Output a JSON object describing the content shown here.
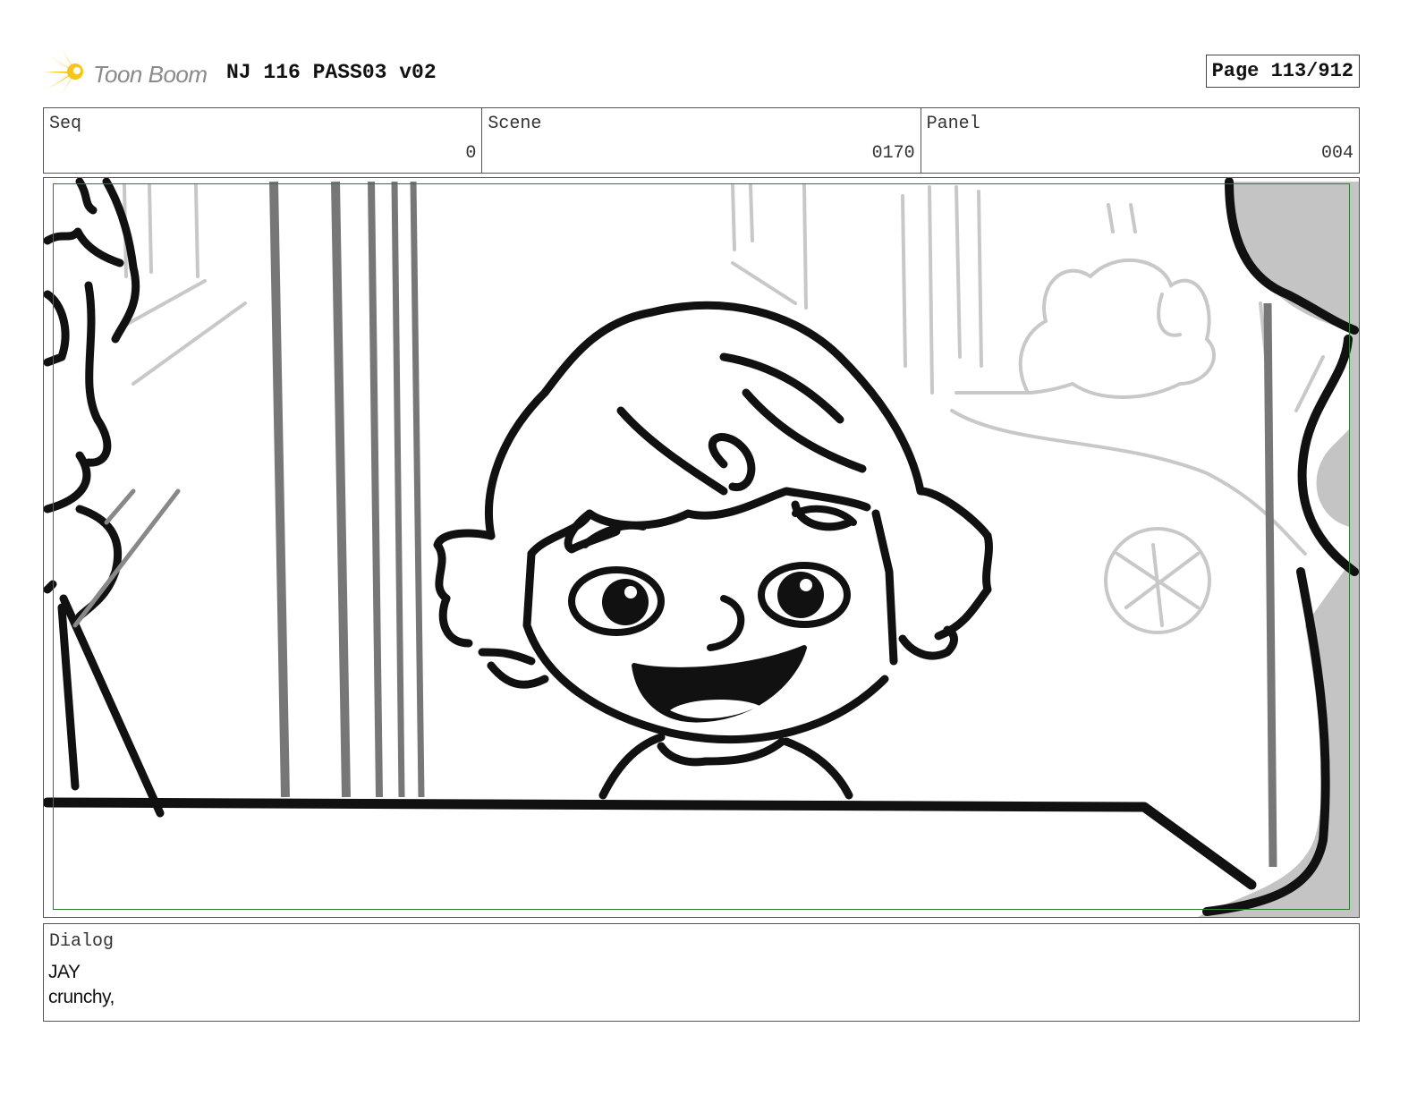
{
  "header": {
    "logo_text": "Toon Boom",
    "doc_title": "NJ 116 PASS03 v02",
    "page_label": "Page 113/912"
  },
  "info": {
    "seq_label": "Seq",
    "seq_value": "0",
    "scene_label": "Scene",
    "scene_value": "0170",
    "panel_label": "Panel",
    "panel_value": "004"
  },
  "dialog": {
    "label": "Dialog",
    "lines": [
      "JAY",
      "crunchy,"
    ]
  },
  "colors": {
    "safe_frame": "#2e7d32",
    "logo_flare": "#f5c518"
  }
}
